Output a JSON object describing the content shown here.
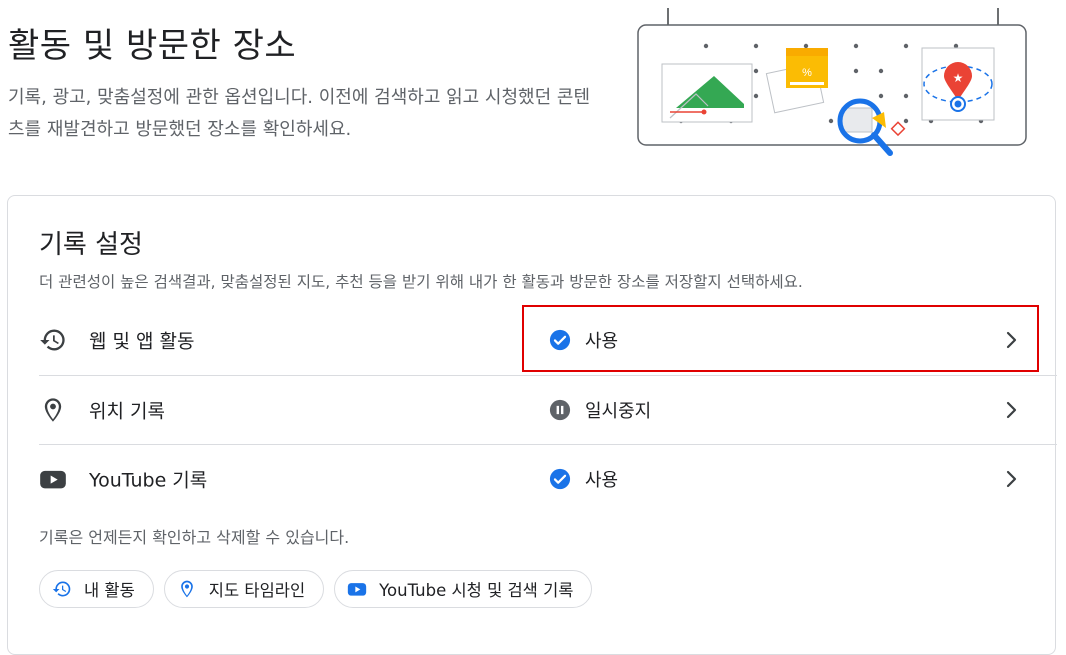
{
  "header": {
    "title": "활동 및 방문한 장소",
    "description": "기록, 광고, 맞춤설정에 관한 옵션입니다. 이전에 검색하고 읽고 시청했던 콘텐츠를 재발견하고 방문했던 장소를 확인하세요."
  },
  "history_settings": {
    "title": "기록 설정",
    "subtitle": "더 관련성이 높은 검색결과, 맞춤설정된 지도, 추천 등을 받기 위해 내가 한 활동과 방문한 장소를 저장할지 선택하세요.",
    "rows": [
      {
        "label": "웹 및 앱 활동",
        "icon": "history-icon",
        "status": "사용",
        "status_icon": "check-circle-icon"
      },
      {
        "label": "위치 기록",
        "icon": "location-pin-icon",
        "status": "일시중지",
        "status_icon": "pause-circle-icon"
      },
      {
        "label": "YouTube 기록",
        "icon": "youtube-icon",
        "status": "사용",
        "status_icon": "check-circle-icon"
      }
    ],
    "note": "기록은 언제든지 확인하고 삭제할 수 있습니다.",
    "chips": [
      {
        "label": "내 활동",
        "icon": "history-icon"
      },
      {
        "label": "지도 타임라인",
        "icon": "location-pin-icon"
      },
      {
        "label": "YouTube 시청 및 검색 기록",
        "icon": "youtube-icon"
      }
    ]
  },
  "colors": {
    "accent_blue": "#1a73e8",
    "status_grey": "#5f6368",
    "highlight_red": "#e00000",
    "divider": "#dadce0"
  }
}
